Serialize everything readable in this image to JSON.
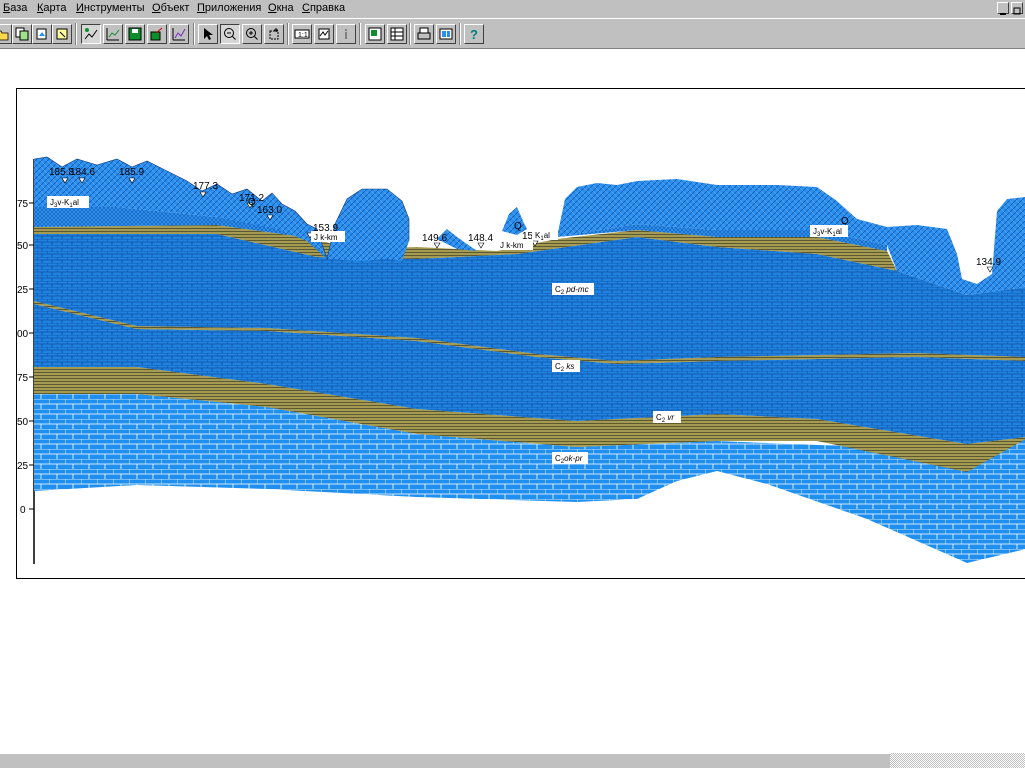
{
  "menu": {
    "items": [
      "База",
      "Карта",
      "Инструменты",
      "Объект",
      "Приложения",
      "Окна",
      "Справка"
    ]
  },
  "toolbar": {
    "buttons": [
      {
        "name": "open-icon"
      },
      {
        "name": "copy-map-icon"
      },
      {
        "name": "paste-map-icon"
      },
      {
        "name": "select-object-icon"
      },
      {
        "name": "edit-section-icon"
      },
      {
        "name": "chart-edit-icon"
      },
      {
        "name": "save-green-icon"
      },
      {
        "name": "chart-save-icon"
      },
      {
        "name": "chart-line-icon"
      },
      {
        "name": "pointer-icon"
      },
      {
        "name": "zoom-out-icon"
      },
      {
        "name": "zoom-in-icon"
      },
      {
        "name": "zoom-frame-icon"
      },
      {
        "name": "scale-icon"
      },
      {
        "name": "map-region-icon"
      },
      {
        "name": "info-icon"
      },
      {
        "name": "layer-add-icon"
      },
      {
        "name": "table-icon"
      },
      {
        "name": "print-icon"
      },
      {
        "name": "print-preview-icon"
      },
      {
        "name": "help-icon"
      }
    ]
  },
  "section": {
    "y_ticks": [
      "75",
      "50",
      "25",
      "00",
      "75",
      "50",
      "25",
      "0"
    ],
    "elevations": [
      "185.8",
      "184.6",
      "185.9",
      "177.3",
      "171.2",
      "163.0",
      "153.9",
      "149.6",
      "148.4",
      "150.",
      "134.9"
    ],
    "well_marks": [
      "Q",
      "Q",
      "Q"
    ],
    "formations": [
      "J3v-K1al",
      "J k-km",
      "J k-km",
      "J3v-K1al",
      "C2 pd-mc",
      "C2 ks",
      "C2 vr",
      "C2ok-pr"
    ],
    "formation_parts": {
      "f1": {
        "a": "J",
        "s": "3",
        "b": "v-K",
        "s2": "1",
        "c": "al"
      },
      "f2": {
        "a": "J k-km"
      },
      "f3": {
        "a": "J k-km"
      },
      "f4": {
        "a": "J",
        "s": "3",
        "b": "v-K",
        "s2": "1",
        "c": "al"
      },
      "f5": {
        "a": "C",
        "s": "2",
        "b": " pd-mc"
      },
      "f6": {
        "a": "C",
        "s": "2",
        "b": " ks"
      },
      "f7": {
        "a": "C",
        "s": "2",
        "b": " vr"
      },
      "f8": {
        "a": "C",
        "s": "2",
        "b": "ok-pr"
      }
    },
    "small_label": "K",
    "small_label_sub": "1",
    "small_label_tail": "al"
  },
  "colors": {
    "window_bg": "#c0c0c0",
    "rock_blue": "#2b8ff0",
    "rock_dark": "#0a4fa0",
    "sand": "#a59a52",
    "sand_line": "#4b4a2a"
  }
}
